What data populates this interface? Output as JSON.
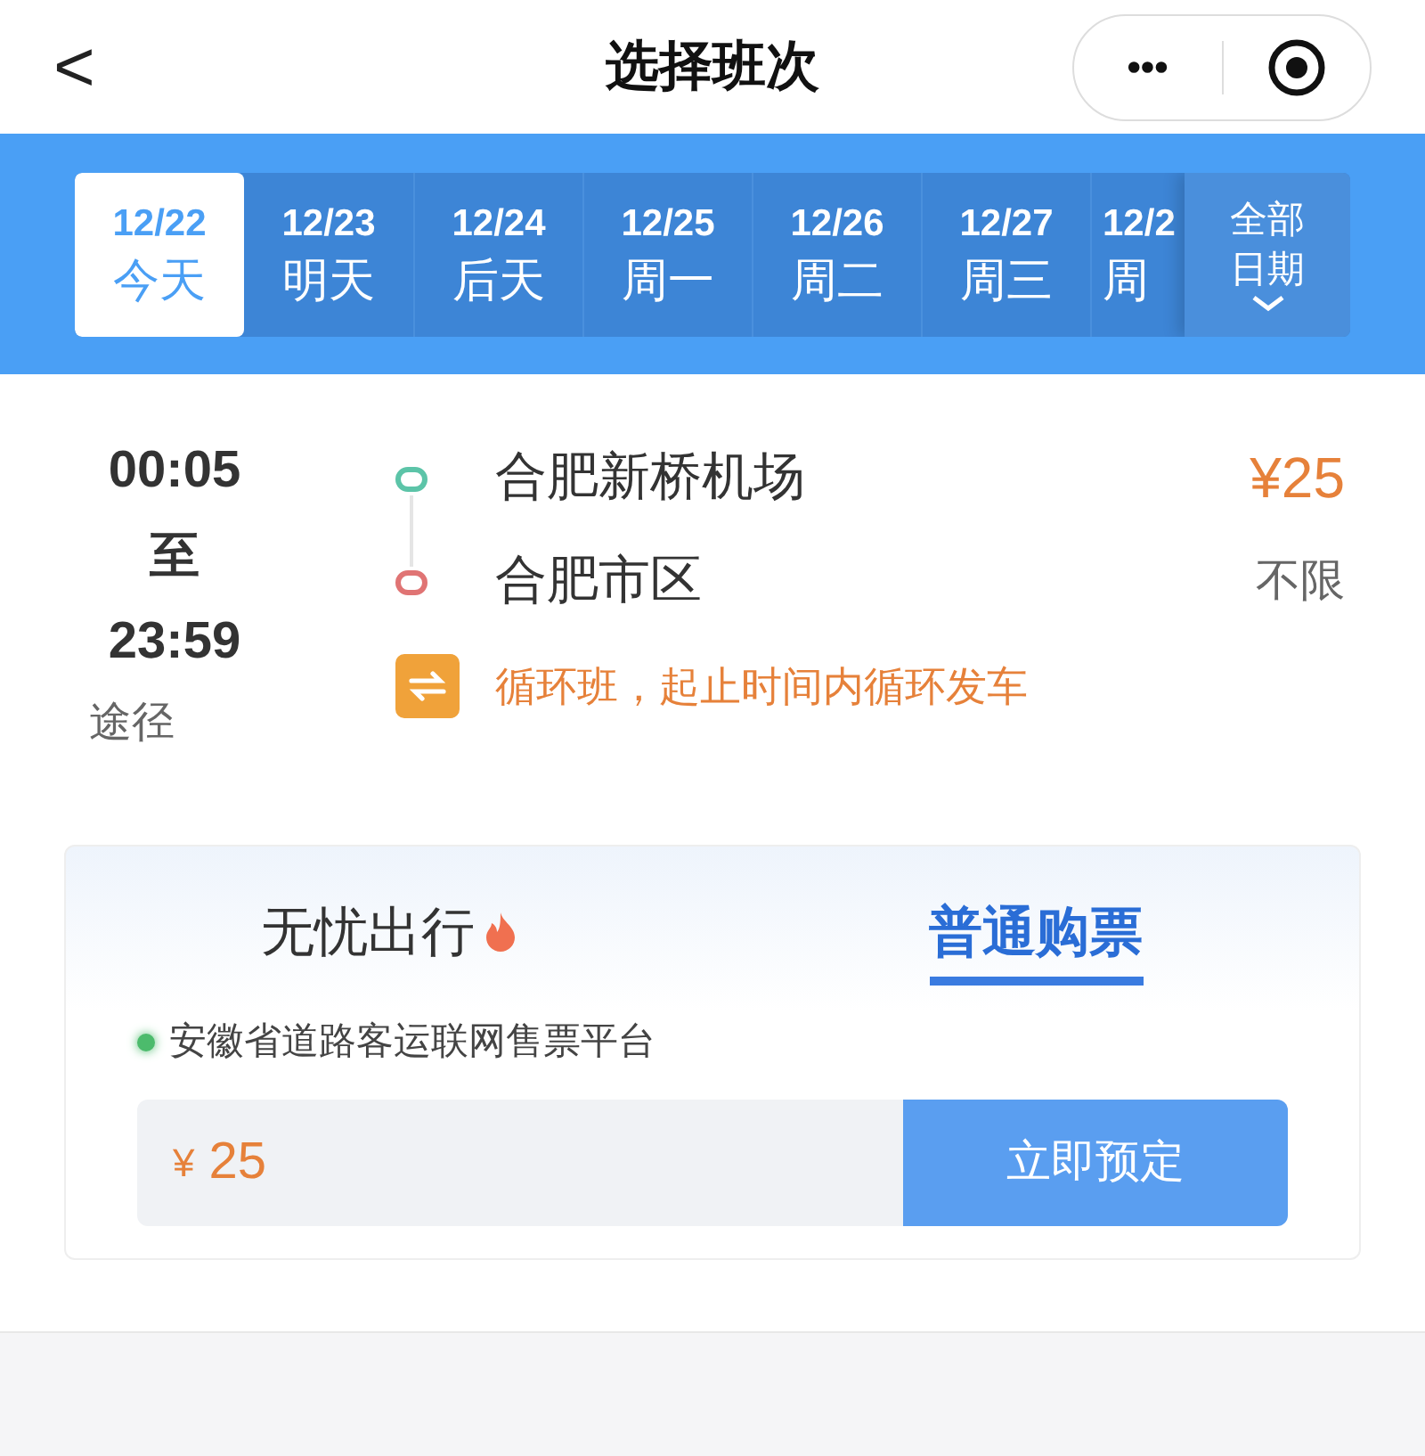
{
  "header": {
    "back": "<",
    "title": "选择班次",
    "more": "•••"
  },
  "dates": [
    {
      "date": "12/22",
      "day": "今天",
      "selected": true
    },
    {
      "date": "12/23",
      "day": "明天",
      "selected": false
    },
    {
      "date": "12/24",
      "day": "后天",
      "selected": false
    },
    {
      "date": "12/25",
      "day": "周一",
      "selected": false
    },
    {
      "date": "12/26",
      "day": "周二",
      "selected": false
    },
    {
      "date": "12/27",
      "day": "周三",
      "selected": false
    },
    {
      "date": "12/2",
      "day": "周",
      "selected": false
    }
  ],
  "all_dates": {
    "line1": "全部",
    "line2": "日期"
  },
  "trip": {
    "start_time": "00:05",
    "to": "至",
    "end_time": "23:59",
    "via": "途径",
    "stops": [
      {
        "name": "合肥新桥机场",
        "color": "#5cc4a8"
      },
      {
        "name": "合肥市区",
        "color": "#e07474"
      }
    ],
    "note": "循环班，起止时间内循环发车",
    "price": "¥25",
    "seats": "不限"
  },
  "booking": {
    "tabs": [
      {
        "label": "无忧出行",
        "hot": true,
        "selected": false
      },
      {
        "label": "普通购票",
        "hot": false,
        "selected": true
      }
    ],
    "platform": "安徽省道路客运联网售票平台",
    "currency": "¥",
    "amount": "25",
    "button": "立即预定"
  }
}
